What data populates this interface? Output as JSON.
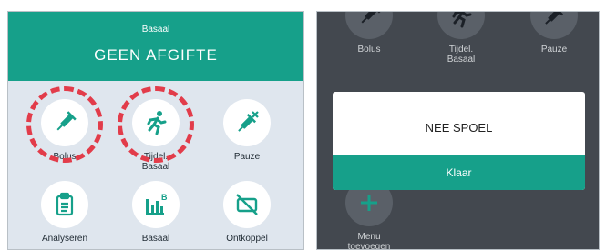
{
  "left": {
    "header": {
      "subtitle": "Basaal",
      "title": "GEEN AFGIFTE"
    },
    "tiles": [
      {
        "label": "Bolus",
        "icon": "syringe-icon"
      },
      {
        "label": "Tijdel.\nBasaal",
        "icon": "running-person-icon"
      },
      {
        "label": "Pauze",
        "icon": "syringe-pause-icon"
      },
      {
        "label": "Analyseren",
        "icon": "clipboard-icon"
      },
      {
        "label": "Basaal",
        "icon": "basal-chart-icon"
      },
      {
        "label": "Ontkoppel",
        "icon": "disconnect-icon"
      }
    ]
  },
  "right": {
    "tiles": [
      {
        "label": "Bolus",
        "icon": "syringe-icon"
      },
      {
        "label": "Tijdel.\nBasaal",
        "icon": "running-person-icon"
      },
      {
        "label": "Pauze",
        "icon": "syringe-pause-icon"
      },
      {
        "label": "Menu\ntoevoegen",
        "icon": "plus-icon"
      }
    ],
    "dialog": {
      "message": "NEE SPOEL",
      "button": "Klaar"
    }
  },
  "colors": {
    "accent": "#16a08a",
    "highlight": "#e23c4a",
    "left_bg": "#dfe6ee",
    "right_bg": "#43484f"
  }
}
